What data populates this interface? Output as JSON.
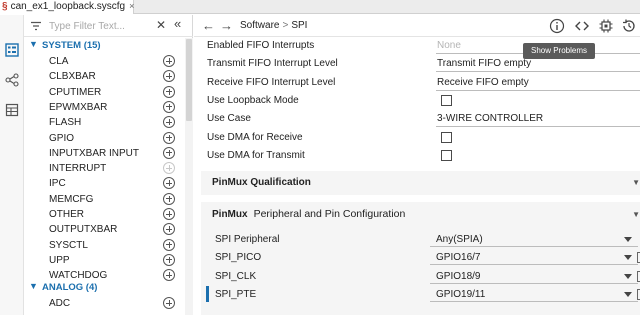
{
  "tab": {
    "title": "can_ex1_loopback.syscfg",
    "close": "×"
  },
  "filter": {
    "placeholder": "Type Filter Text...",
    "clear": "✕",
    "collapse": "«"
  },
  "tree": {
    "categories": [
      {
        "label": "SYSTEM (15)"
      },
      {
        "label": "ANALOG (4)"
      }
    ],
    "system_items": [
      {
        "label": "CLA",
        "enabled": true
      },
      {
        "label": "CLBXBAR",
        "enabled": true
      },
      {
        "label": "CPUTIMER",
        "enabled": true
      },
      {
        "label": "EPWMXBAR",
        "enabled": true
      },
      {
        "label": "FLASH",
        "enabled": true
      },
      {
        "label": "GPIO",
        "enabled": true
      },
      {
        "label": "INPUTXBAR INPUT",
        "enabled": true
      },
      {
        "label": "INTERRUPT",
        "enabled": false
      },
      {
        "label": "IPC",
        "enabled": true
      },
      {
        "label": "MEMCFG",
        "enabled": true
      },
      {
        "label": "OTHER",
        "enabled": true
      },
      {
        "label": "OUTPUTXBAR",
        "enabled": true
      },
      {
        "label": "SYSCTL",
        "enabled": true
      },
      {
        "label": "UPP",
        "enabled": true
      },
      {
        "label": "WATCHDOG",
        "enabled": true
      }
    ],
    "analog_items": [
      {
        "label": "ADC",
        "enabled": true
      }
    ]
  },
  "toolbar": {
    "back": "←",
    "forward": "→",
    "breadcrumb": [
      "Software",
      "SPI"
    ],
    "separator": ">",
    "tooltip": "Show Problems"
  },
  "properties": [
    {
      "label": "Enabled FIFO Interrupts",
      "type": "text",
      "value": "None",
      "muted": true
    },
    {
      "label": "Transmit FIFO Interrupt Level",
      "type": "text",
      "value": "Transmit FIFO empty"
    },
    {
      "label": "Receive FIFO Interrupt Level",
      "type": "text",
      "value": "Receive FIFO empty"
    },
    {
      "label": "Use Loopback Mode",
      "type": "checkbox",
      "checked": false
    },
    {
      "label": "Use Case",
      "type": "text",
      "value": "3-WIRE CONTROLLER"
    },
    {
      "label": "Use DMA for Receive",
      "type": "checkbox",
      "checked": false
    },
    {
      "label": "Use DMA for Transmit",
      "type": "checkbox",
      "checked": false
    }
  ],
  "sections": {
    "qualification": {
      "title": "PinMux Qualification"
    },
    "pinmux": {
      "title": "PinMux",
      "subtitle": "Peripheral and Pin Configuration"
    }
  },
  "pinmux_rows": [
    {
      "label": "SPI Peripheral",
      "value": "Any(SPIA)"
    },
    {
      "label": "SPI_PICO",
      "value": "GPIO16/7"
    },
    {
      "label": "SPI_CLK",
      "value": "GPIO18/9"
    },
    {
      "label": "SPI_PTE",
      "value": "GPIO19/11"
    }
  ],
  "colors": {
    "accent": "#1b6fae",
    "tooltip_bg": "#5a5a5a",
    "tab_icon": "#c0392b"
  }
}
